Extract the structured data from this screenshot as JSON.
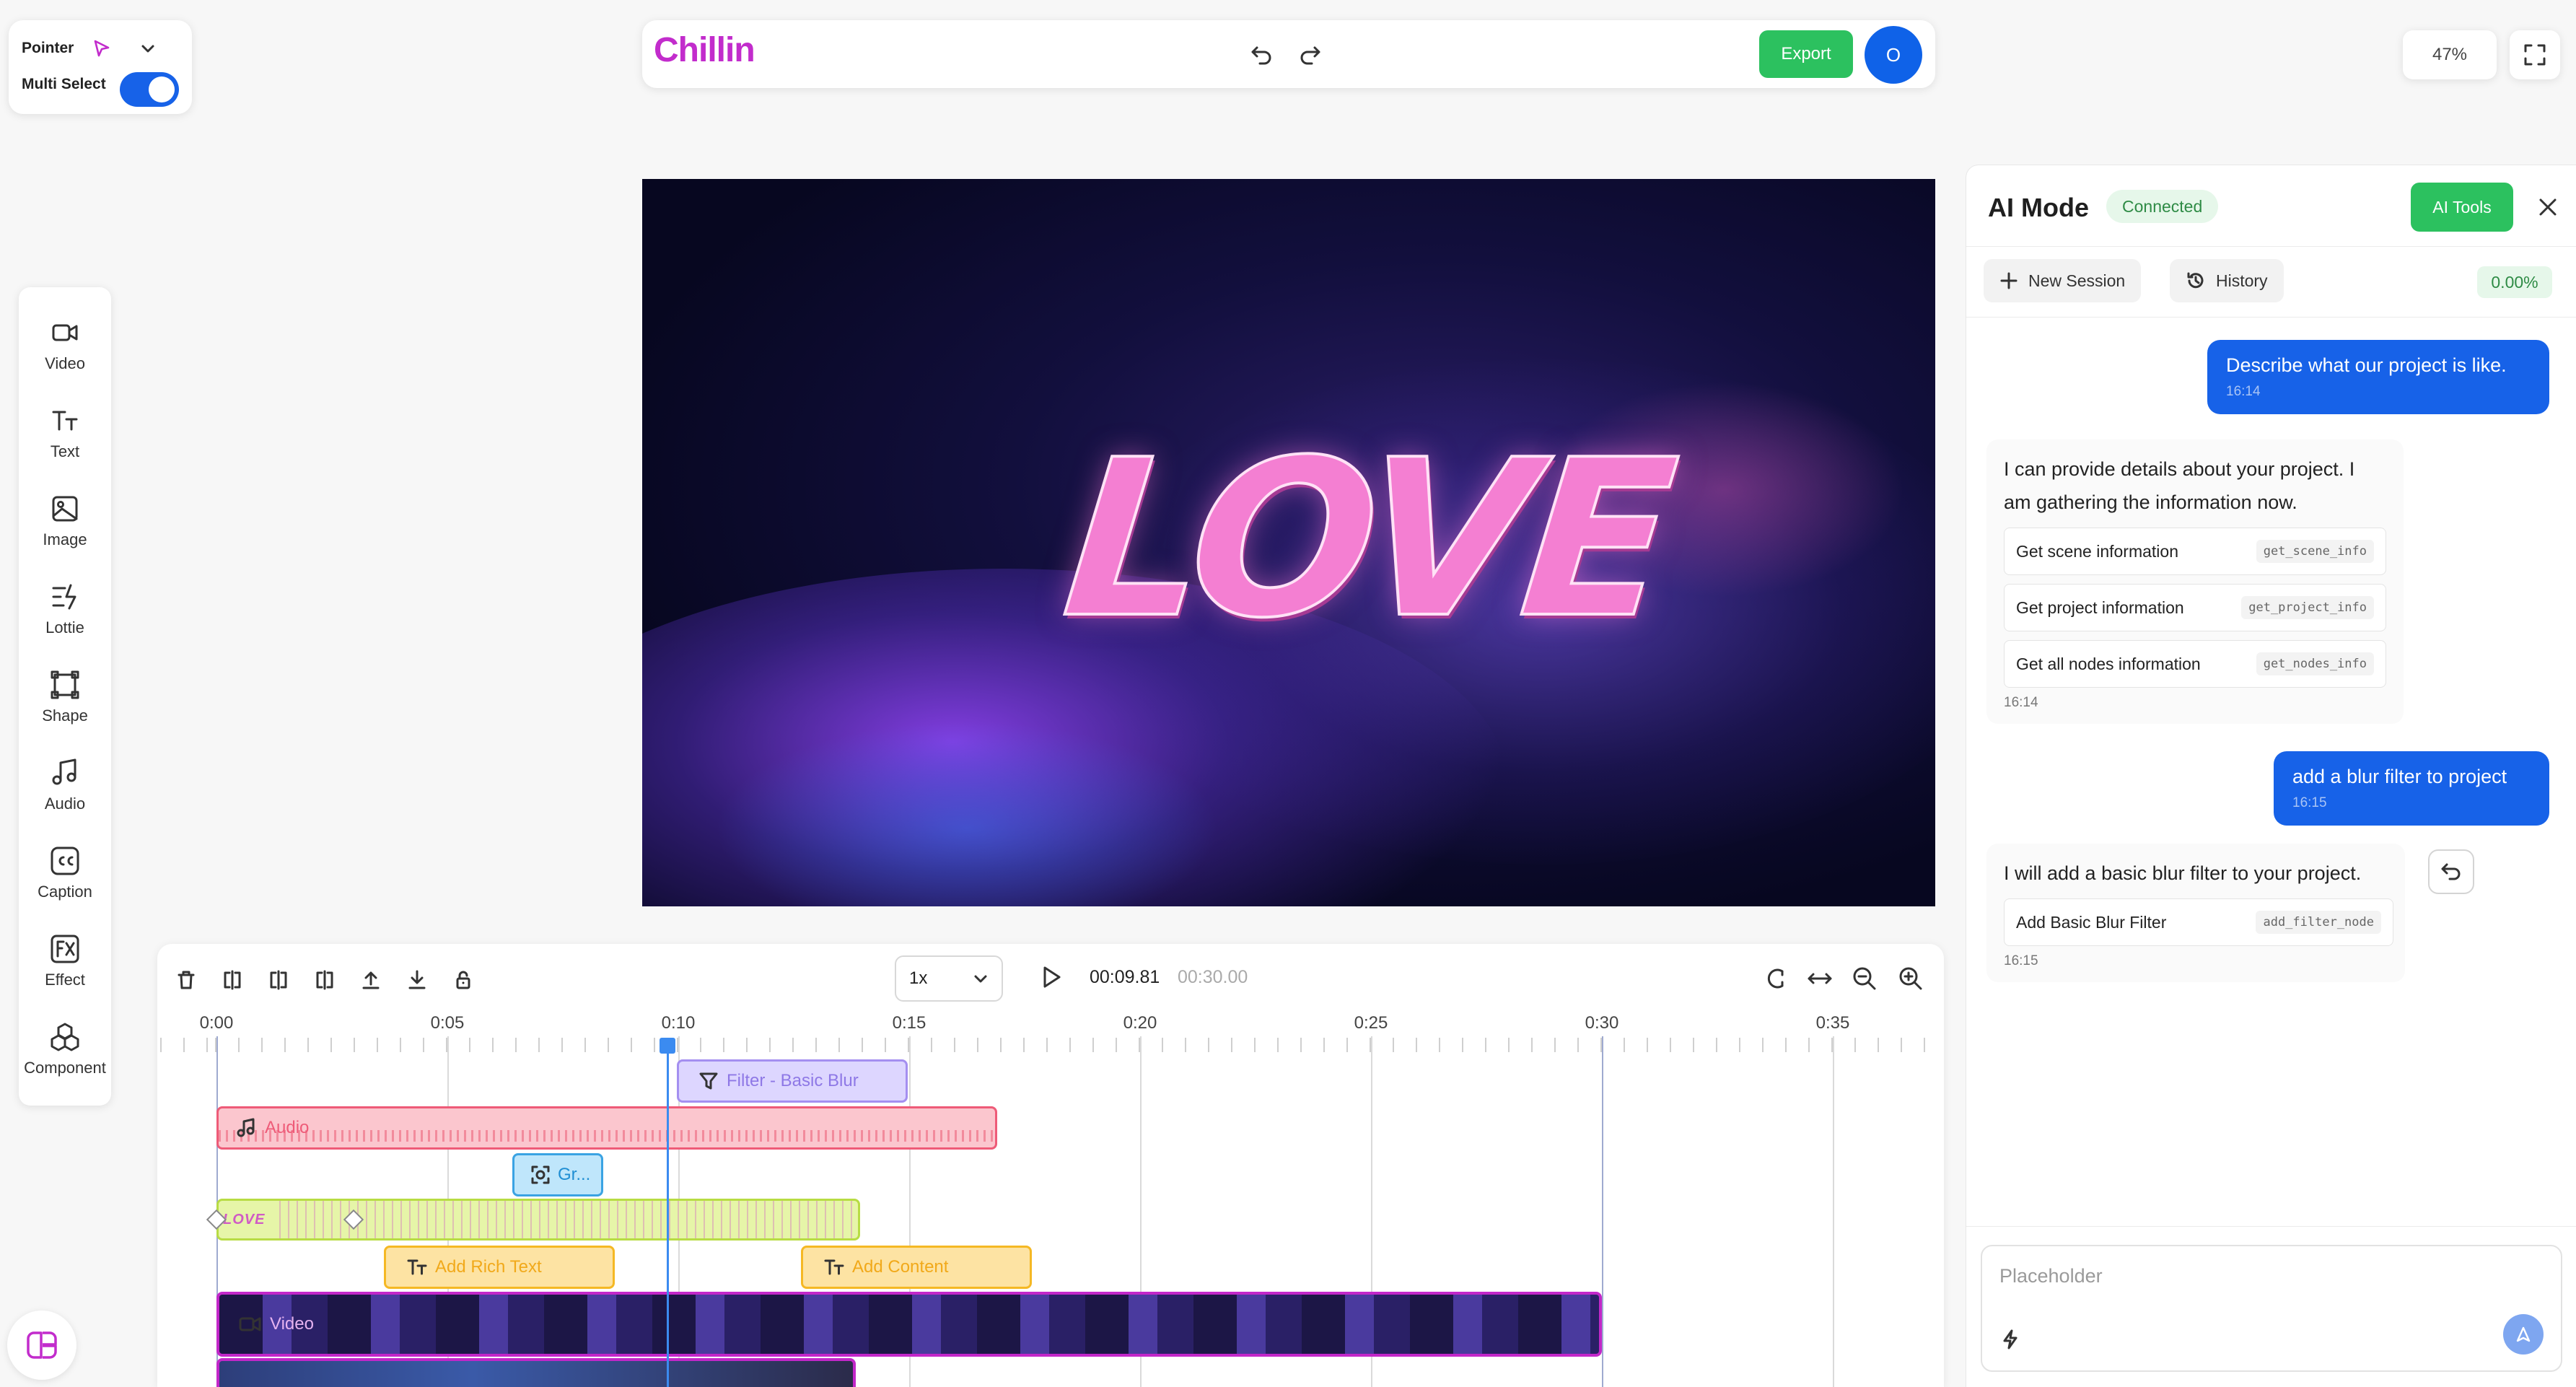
{
  "pointer_card": {
    "tool_label": "Pointer",
    "multi_select_label": "Multi Select",
    "multi_select_on": true
  },
  "topbar": {
    "logo": "Chillin",
    "export_label": "Export",
    "avatar_initial": "O"
  },
  "zoom_level": "47%",
  "sidebar": {
    "items": [
      {
        "label": "Video",
        "icon": "video-icon"
      },
      {
        "label": "Text",
        "icon": "text-icon"
      },
      {
        "label": "Image",
        "icon": "image-icon"
      },
      {
        "label": "Lottie",
        "icon": "lottie-icon"
      },
      {
        "label": "Shape",
        "icon": "shape-icon"
      },
      {
        "label": "Audio",
        "icon": "music-icon"
      },
      {
        "label": "Caption",
        "icon": "cc-icon"
      },
      {
        "label": "Effect",
        "icon": "fx-icon"
      },
      {
        "label": "Component",
        "icon": "component-icon"
      }
    ]
  },
  "canvas": {
    "text": "LOVE"
  },
  "ai_panel": {
    "title": "AI Mode",
    "status": "Connected",
    "tools_label": "AI Tools",
    "new_session_label": "New Session",
    "history_label": "History",
    "progress": "0.00%",
    "messages": [
      {
        "role": "user",
        "text": "Describe what our project is like.",
        "time": "16:14"
      },
      {
        "role": "ai",
        "text": "I can provide details about your project. I am gathering the information now.",
        "tools": [
          {
            "label": "Get scene information",
            "code": "get_scene_info"
          },
          {
            "label": "Get project information",
            "code": "get_project_info"
          },
          {
            "label": "Get all nodes information",
            "code": "get_nodes_info"
          }
        ],
        "time": "16:14"
      },
      {
        "role": "user",
        "text": "add a blur filter to project",
        "time": "16:15"
      },
      {
        "role": "ai",
        "text": "I will add a basic blur filter to your project.",
        "tools": [
          {
            "label": "Add Basic Blur Filter",
            "code": "add_filter_node"
          }
        ],
        "time": "16:15"
      }
    ],
    "input_placeholder": "Placeholder"
  },
  "timeline": {
    "speed": "1x",
    "current_time": "00:09.81",
    "total_time": "00:30.00",
    "ticks": [
      "0:00",
      "0:05",
      "0:10",
      "0:15",
      "0:20",
      "0:25",
      "0:30",
      "0:35"
    ],
    "clips": {
      "filter": "Filter - Basic Blur",
      "audio": "Audio",
      "group": "Gr...",
      "love_text": "LOVE",
      "rich_text": "Add Rich Text",
      "content": "Add Content",
      "video": "Video"
    }
  }
}
